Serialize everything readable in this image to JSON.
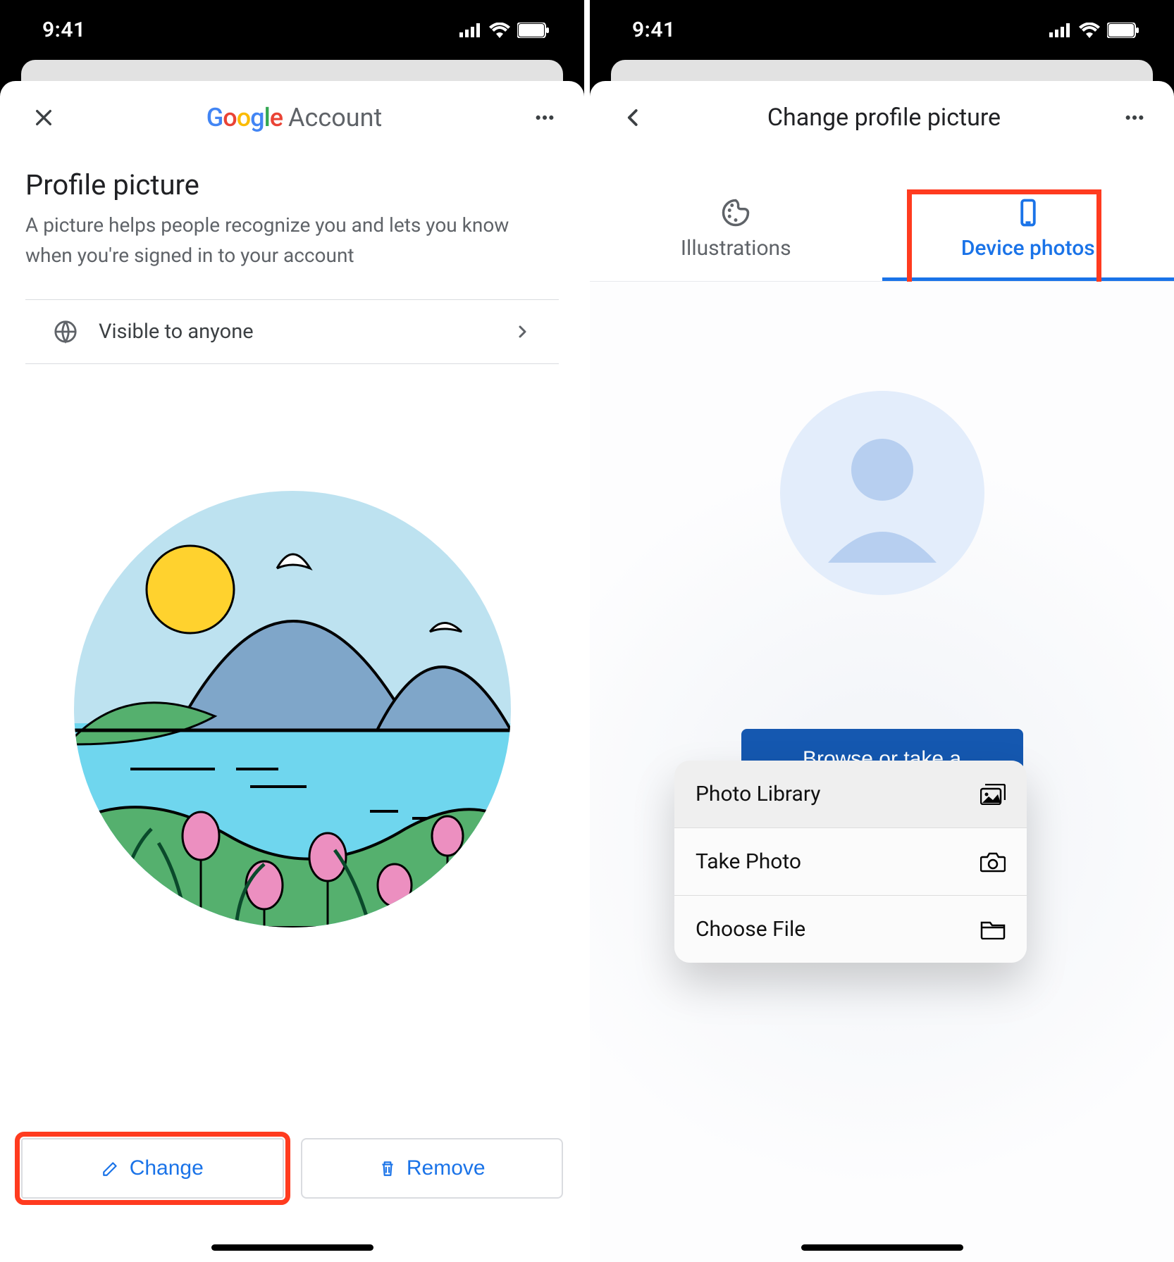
{
  "status": {
    "time": "9:41"
  },
  "left": {
    "header_brand": "Google",
    "header_suffix": "Account",
    "section_title": "Profile picture",
    "section_desc": "A picture helps people recognize you and lets you know when you're signed in to your account",
    "visibility": "Visible to anyone",
    "change_label": "Change",
    "remove_label": "Remove"
  },
  "right": {
    "title": "Change profile picture",
    "tab_illustrations": "Illustrations",
    "tab_device": "Device photos",
    "browse_label": "Browse or take a photo",
    "menu": {
      "photo_library": "Photo Library",
      "take_photo": "Take Photo",
      "choose_file": "Choose File"
    }
  }
}
